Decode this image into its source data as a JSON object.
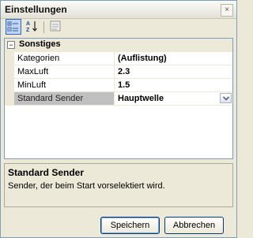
{
  "window": {
    "title": "Einstellungen",
    "close_glyph": "×"
  },
  "toolbar": {
    "buttons": [
      "categorized-view-icon",
      "alphabetical-sort-icon",
      "property-pages-icon"
    ]
  },
  "grid": {
    "category": {
      "name": "Sonstiges",
      "expander": "−"
    },
    "properties": [
      {
        "name": "Kategorien",
        "value": "(Auflistung)"
      },
      {
        "name": "MaxLuft",
        "value": "2.3"
      },
      {
        "name": "MinLuft",
        "value": "1.5"
      },
      {
        "name": "Standard Sender",
        "value": "Hauptwelle",
        "selected": true
      }
    ]
  },
  "description": {
    "title": "Standard Sender",
    "text": "Sender, der beim Start vorselektiert wird."
  },
  "buttons": {
    "save": "Speichern",
    "cancel": "Abbrechen"
  }
}
